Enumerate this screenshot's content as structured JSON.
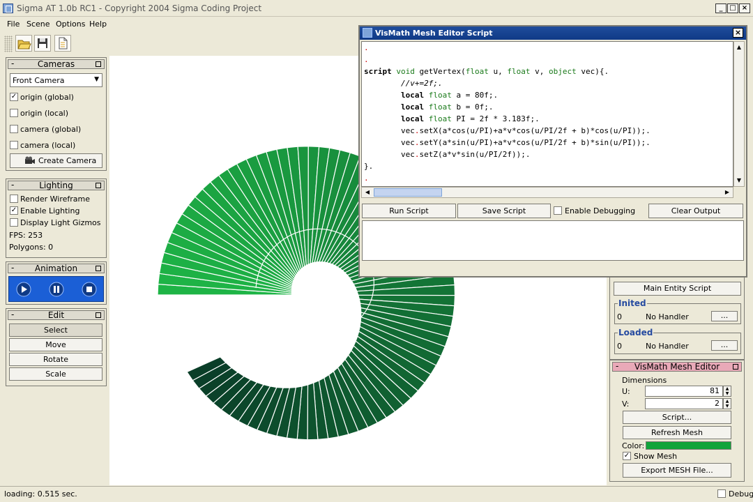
{
  "window": {
    "title": "Sigma AT 1.0b RC1 - Copyright 2004 Sigma Coding Project"
  },
  "menu": [
    "File",
    "Scene",
    "Options",
    "Help"
  ],
  "toolbar": {
    "buttons": [
      "open-icon",
      "save-icon",
      "new-document-icon"
    ]
  },
  "cameras": {
    "title": "Cameras",
    "selected": "Front Camera",
    "options": [
      {
        "label": "origin (global)",
        "checked": true
      },
      {
        "label": "origin (local)",
        "checked": false
      },
      {
        "label": "camera (global)",
        "checked": false
      },
      {
        "label": "camera (local)",
        "checked": false
      }
    ],
    "create_label": "Create Camera"
  },
  "lighting": {
    "title": "Lighting",
    "options": [
      {
        "label": "Render Wireframe",
        "checked": false
      },
      {
        "label": "Enable Lighting",
        "checked": true
      },
      {
        "label": "Display Light Gizmos",
        "checked": false
      }
    ],
    "fps": "FPS: 253",
    "polygons": "Polygons: 0"
  },
  "animation": {
    "title": "Animation",
    "controls": [
      "play-icon",
      "pause-icon",
      "stop-icon"
    ]
  },
  "edit": {
    "title": "Edit",
    "buttons": [
      "Select",
      "Move",
      "Rotate",
      "Scale"
    ]
  },
  "status": {
    "text": "loading: 0.515 sec.",
    "debug_label": "Debug"
  },
  "editor": {
    "title": "VisMath Mesh Editor Script",
    "code_lines": [
      ".",
      ".",
      "script void getVertex(float u, float v, object vec){.",
      "        //v+=2f;.",
      "        local float a = 80f;.",
      "        local float b = 0f;.",
      "        local float PI = 2f * 3.183f;.",
      "        vec.setX(a*cos(u/PI)+a*v*cos(u/PI/2f + b)*cos(u/PI));.",
      "        vec.setY(a*sin(u/PI)+a*v*cos(u/PI/2f + b)*sin(u/PI));.",
      "        vec.setZ(a*v*sin(u/PI/2f));.",
      "}.",
      "."
    ],
    "run_label": "Run Script",
    "save_label": "Save Script",
    "debug_label": "Enable Debugging",
    "clear_label": "Clear Output",
    "output": ""
  },
  "entity": {
    "main_script_label": "Main Entity Script",
    "inited": {
      "title": "Inited",
      "count": "0",
      "handler": "No Handler",
      "button": "..."
    },
    "loaded": {
      "title": "Loaded",
      "count": "0",
      "handler": "No Handler",
      "button": "..."
    }
  },
  "mesh_editor": {
    "title": "VisMath Mesh Editor",
    "dimensions_label": "Dimensions",
    "u_label": "U:",
    "u_value": "81",
    "v_label": "V:",
    "v_value": "2",
    "script_label": "Script...",
    "refresh_label": "Refresh Mesh",
    "color_label": "Color:",
    "color": "#11a43a",
    "show_mesh_label": "Show Mesh",
    "show_mesh": true,
    "export_label": "Export MESH File..."
  },
  "colors": {
    "mesh_light": "#1fb24a",
    "mesh_dark": "#0a4a18",
    "accent": "#254aa0",
    "titlebar": "#0f3a86"
  }
}
